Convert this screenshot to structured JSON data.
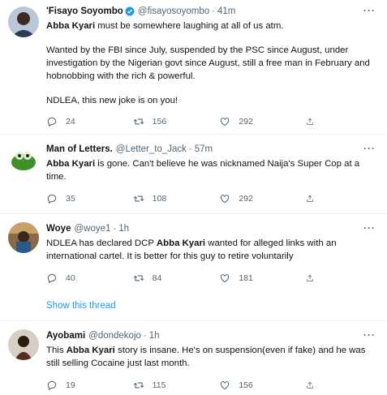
{
  "tweets": [
    {
      "name": "'Fisayo Soyombo",
      "verified": true,
      "handle": "@fisayosoyombo",
      "time": "41m",
      "text_parts": [
        {
          "bold": "Abba Kyari",
          "rest": " must be somewhere laughing at all of us atm."
        },
        {
          "plain": "Wanted by the FBI since July, suspended by the PSC since August, under investigation by the Nigerian govt since August, still a free man in February and hobnobbing with the rich & powerful."
        },
        {
          "plain": "NDLEA, this new joke is on you!"
        }
      ],
      "replies": "24",
      "retweets": "156",
      "likes": "292"
    },
    {
      "name": "Man of Letters.",
      "handle": "@Letter_to_Jack",
      "time": "57m",
      "bold": "Abba Kyari",
      "rest": " is gone. Can't believe he was nicknamed Naija's Super Cop at a time.",
      "replies": "35",
      "retweets": "108",
      "likes": "292"
    },
    {
      "name": "Woye",
      "handle": "@woye1",
      "time": "1h",
      "before": "NDLEA has declared DCP ",
      "bold": "Abba Kyari",
      "rest": " wanted for alleged links with an international cartel. It is better for this guy to retire voluntarily",
      "replies": "40",
      "retweets": "84",
      "likes": "181"
    },
    {
      "name": "Ayobami",
      "handle": "@dondekojo",
      "time": "1h",
      "before": "This ",
      "bold": "Abba Kyari",
      "rest": " story is insane. He's on suspension(even if fake) and he was still selling Cocaine just last month.",
      "replies": "19",
      "retweets": "115",
      "likes": "156"
    }
  ],
  "show_thread": "Show this thread",
  "more_glyph": "···",
  "dot": "·",
  "colors": {
    "accent": "#1d9bf0",
    "muted": "#536471",
    "text": "#0f1419",
    "divider": "#eff3f4"
  },
  "icons": [
    "reply-icon",
    "retweet-icon",
    "like-icon",
    "share-icon",
    "verified-badge-icon",
    "more-icon"
  ]
}
